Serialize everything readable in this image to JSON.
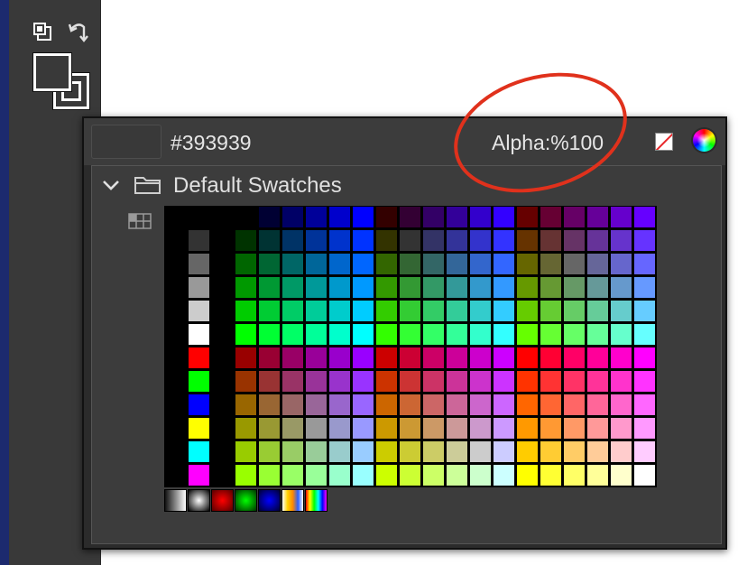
{
  "tools": {
    "swap_icon": "swap-colors-icon",
    "undo_icon": "undo-arrow-icon",
    "fill_color": "#393939",
    "stroke_color": "#393939"
  },
  "picker": {
    "hex": "#393939",
    "alpha_label": "Alpha:%100",
    "preview_color": "#393939",
    "no_color_icon": "no-color-icon",
    "wheel_icon": "color-wheel-icon"
  },
  "swatches": {
    "group_title": "Default Swatches",
    "left_column": [
      "#000000",
      "#333333",
      "#666666",
      "#999999",
      "#cccccc",
      "#ffffff",
      "#ff0000",
      "#00ff00",
      "#0000ff",
      "#ffff00",
      "#00ffff",
      "#ff00ff"
    ],
    "gradient_row": [
      "black-white-linear",
      "white-black-radial",
      "red-radial",
      "green-radial",
      "blue-radial",
      "rainbow-linear",
      "rainbow-linear-2"
    ]
  },
  "annotation": {
    "color": "#e0311c"
  }
}
